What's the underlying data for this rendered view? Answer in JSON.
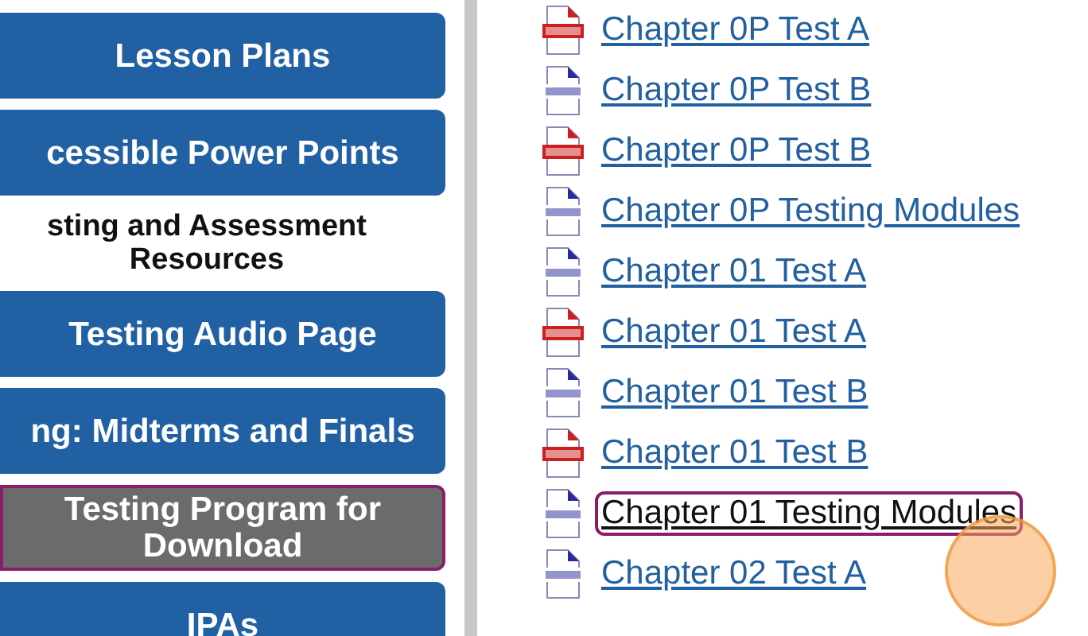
{
  "sidebar": {
    "items": [
      {
        "kind": "button",
        "label": "Lesson Plans",
        "selected": false
      },
      {
        "kind": "button",
        "label": "cessible Power Points",
        "selected": false
      },
      {
        "kind": "heading",
        "label": "sting and Assessment Resources"
      },
      {
        "kind": "button",
        "label": "Testing Audio Page",
        "selected": false
      },
      {
        "kind": "button",
        "label": "ng: Midterms and Finals",
        "selected": false
      },
      {
        "kind": "button",
        "label": "Testing Program for Download",
        "selected": true
      },
      {
        "kind": "button",
        "label": "IPAs",
        "selected": false
      }
    ]
  },
  "files": [
    {
      "kind": "pdf",
      "label": "Chapter 0P Test A",
      "focused": false
    },
    {
      "kind": "doc",
      "label": "Chapter 0P Test B",
      "focused": false
    },
    {
      "kind": "pdf",
      "label": "Chapter 0P Test B",
      "focused": false
    },
    {
      "kind": "doc",
      "label": "Chapter 0P Testing Modules",
      "focused": false
    },
    {
      "kind": "doc",
      "label": "Chapter 01 Test A",
      "focused": false
    },
    {
      "kind": "pdf",
      "label": "Chapter 01 Test A",
      "focused": false
    },
    {
      "kind": "doc",
      "label": "Chapter 01 Test B",
      "focused": false
    },
    {
      "kind": "pdf",
      "label": "Chapter 01 Test B",
      "focused": false
    },
    {
      "kind": "doc",
      "label": "Chapter 01 Testing Modules",
      "focused": true
    },
    {
      "kind": "doc",
      "label": "Chapter 02 Test A",
      "focused": false
    }
  ]
}
